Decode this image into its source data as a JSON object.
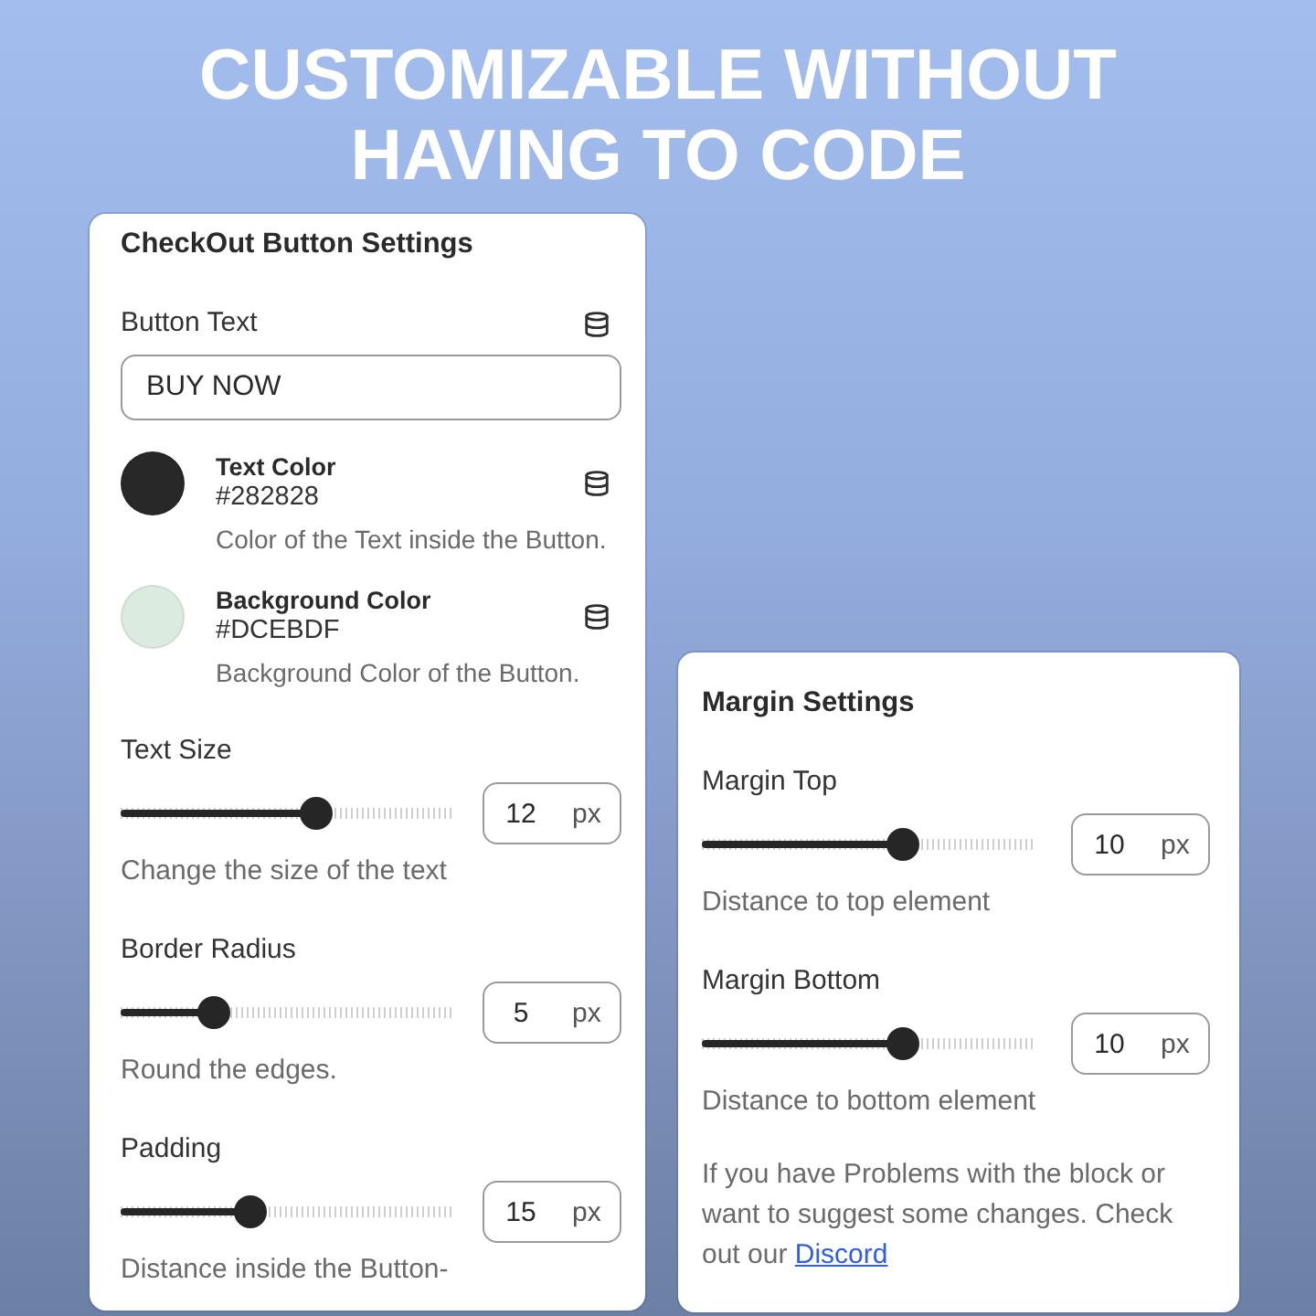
{
  "headline": [
    "CUSTOMIZABLE WITHOUT",
    "HAVING TO CODE"
  ],
  "checkout_panel": {
    "title": "CheckOut Button Settings",
    "fields": [
      {
        "kind": "text",
        "label": "Button Text",
        "value": "BUY NOW"
      },
      {
        "kind": "color",
        "label": "Text Color",
        "value": "#282828",
        "color": "#282828",
        "description": "Color of the Text inside the Button."
      },
      {
        "kind": "color",
        "label": "Background Color",
        "value": "#DCEBDF",
        "color": "#dcebdf",
        "description": "Background Color of the Button."
      },
      {
        "kind": "slider",
        "label": "Text Size",
        "level": 0.59,
        "value": "12",
        "unit": "px",
        "description": "Change the size of the text"
      },
      {
        "kind": "slider",
        "label": "Border Radius",
        "level": 0.28,
        "value": "5",
        "unit": "px",
        "description": "Round the edges."
      },
      {
        "kind": "slider",
        "label": "Padding",
        "level": 0.39,
        "value": "15",
        "unit": "px",
        "description": "Distance inside the Button-"
      }
    ]
  },
  "margin_panel": {
    "title": "Margin Settings",
    "fields": [
      {
        "kind": "slider",
        "label": "Margin Top",
        "level": 0.6,
        "value": "10",
        "unit": "px",
        "description": "Distance to top element"
      },
      {
        "kind": "slider",
        "label": "Margin Bottom",
        "level": 0.6,
        "value": "10",
        "unit": "px",
        "description": "Distance to bottom element"
      }
    ],
    "note": {
      "text": "If you have Problems with the block or want to suggest some changes. Check out our",
      "link": "Discord"
    }
  }
}
